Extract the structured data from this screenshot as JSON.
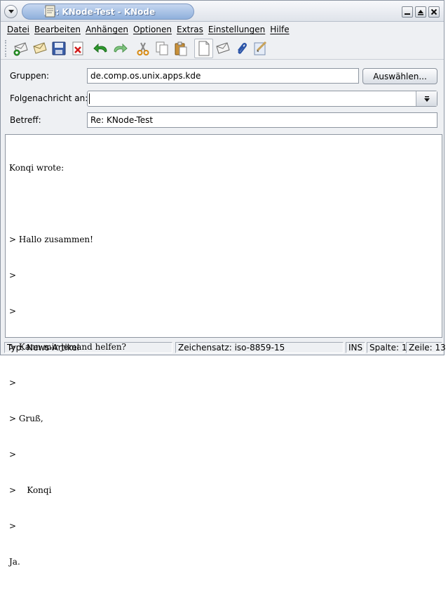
{
  "window": {
    "title": "Re: KNode-Test - KNode"
  },
  "menubar": {
    "items": [
      "Datei",
      "Bearbeiten",
      "Anhängen",
      "Optionen",
      "Extras",
      "Einstellungen",
      "Hilfe"
    ]
  },
  "toolbar": {
    "buttons": [
      {
        "name": "send-now-button",
        "icon": "envelope-send-icon"
      },
      {
        "name": "send-later-button",
        "icon": "envelope-later-icon"
      },
      {
        "name": "save-button",
        "icon": "floppy-disk-icon"
      },
      {
        "name": "delete-button",
        "icon": "delete-x-icon"
      },
      {
        "name": "undo-button",
        "icon": "undo-arrow-icon"
      },
      {
        "name": "redo-button",
        "icon": "redo-arrow-icon"
      },
      {
        "name": "cut-button",
        "icon": "scissors-icon"
      },
      {
        "name": "copy-button",
        "icon": "copy-icon"
      },
      {
        "name": "paste-button",
        "icon": "clipboard-icon"
      },
      {
        "name": "new-document-button",
        "icon": "blank-page-icon"
      },
      {
        "name": "mail-button",
        "icon": "envelope-icon"
      },
      {
        "name": "attach-button",
        "icon": "paperclip-icon"
      },
      {
        "name": "spellcheck-button",
        "icon": "spellcheck-icon"
      }
    ]
  },
  "headers": {
    "groups_label": "Gruppen:",
    "groups_value": "de.comp.os.unix.apps.kde",
    "choose_button": "Auswählen...",
    "followup_label": "Folgenachricht an:",
    "followup_value": "",
    "subject_label": "Betreff:",
    "subject_value": "Re: KNode-Test"
  },
  "editor": {
    "lines": [
      "Konqi wrote:",
      "",
      "> Hallo zusammen!",
      ">",
      ">",
      "> Kann mir jemand helfen?",
      ">",
      "> Gruß,",
      ">",
      ">    Konqi",
      ">",
      "Ja."
    ]
  },
  "statusbar": {
    "type": "Typ: News-Artikel",
    "charset": "Zeichensatz: iso-8859-15",
    "mode": "INS",
    "column": "Spalte: 1",
    "line": "Zeile: 13"
  }
}
